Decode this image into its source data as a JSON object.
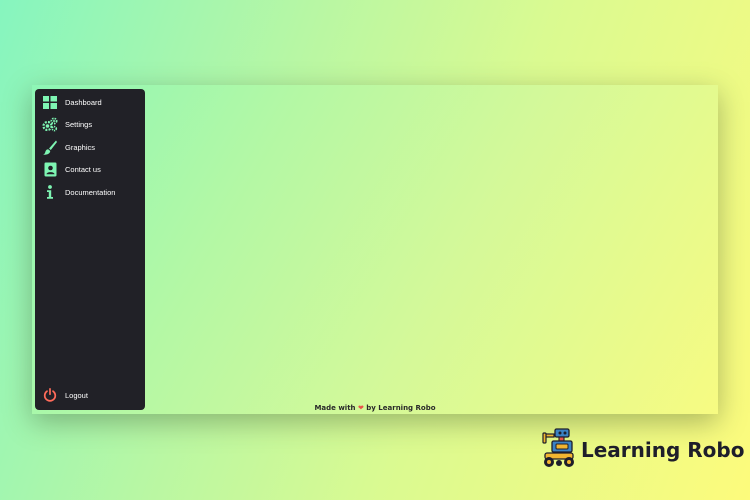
{
  "sidebar": {
    "items": [
      {
        "label": "Dashboard",
        "icon": "dashboard-icon"
      },
      {
        "label": "Settings",
        "icon": "gears-icon"
      },
      {
        "label": "Graphics",
        "icon": "brush-icon"
      },
      {
        "label": "Contact us",
        "icon": "contact-icon"
      },
      {
        "label": "Documentation",
        "icon": "info-icon"
      }
    ],
    "logout": {
      "label": "Logout",
      "icon": "power-icon"
    }
  },
  "footer": {
    "prefix": "Made with",
    "suffix": "by Learning Robo",
    "heart_icon": "heart-icon"
  },
  "brand": {
    "name": "Learning Robo",
    "logo": "robot-logo"
  },
  "colors": {
    "sidebar_bg": "#212127",
    "icon_accent": "#7ef5b3",
    "logout_accent": "#ff6b5a",
    "heart": "#e8534a"
  }
}
